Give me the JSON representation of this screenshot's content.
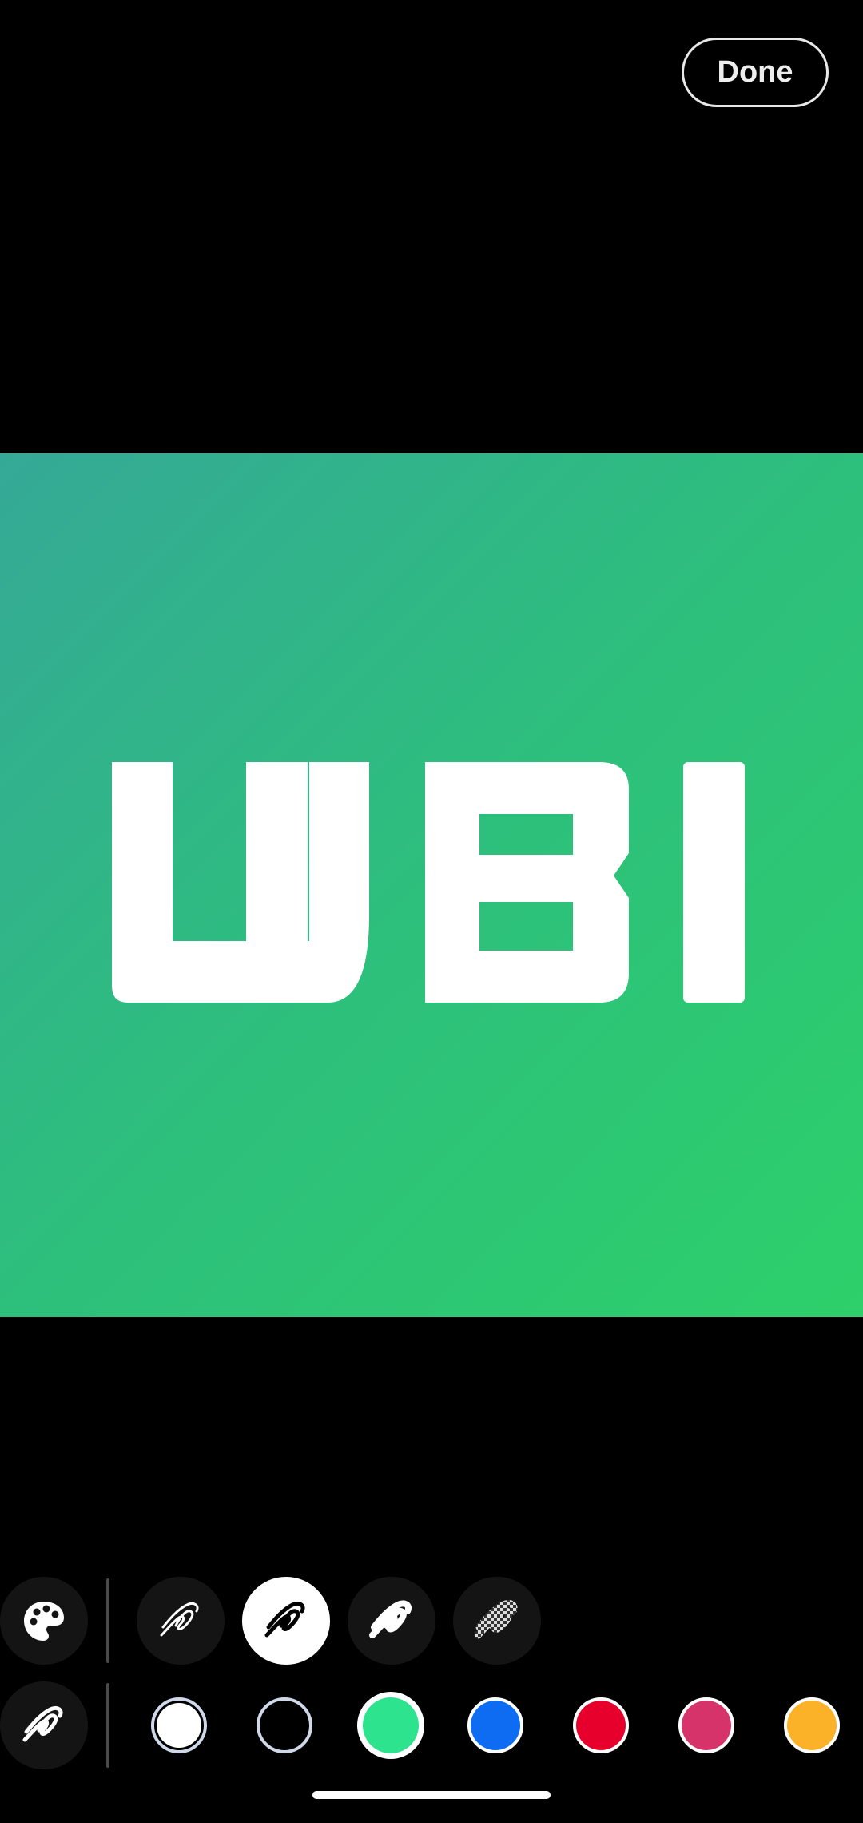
{
  "header": {
    "done_label": "Done"
  },
  "canvas": {
    "image": "wbi-logo-image",
    "logo_text": "WBI",
    "background_colors": [
      "#35a997",
      "#2dd06a"
    ]
  },
  "tools": {
    "palette": {
      "icon": "palette-icon"
    },
    "brushes": [
      {
        "name": "brush-thin",
        "icon": "squiggle-thin-icon",
        "selected": false
      },
      {
        "name": "brush-medium",
        "icon": "squiggle-medium-icon",
        "selected": true
      },
      {
        "name": "brush-thick",
        "icon": "squiggle-thick-icon",
        "selected": false
      },
      {
        "name": "brush-mosaic",
        "icon": "mosaic-brush-icon",
        "selected": false
      }
    ],
    "brush_style_toggle": {
      "icon": "squiggle-style-icon"
    }
  },
  "colors": [
    {
      "name": "white",
      "hex": "#ffffff"
    },
    {
      "name": "black",
      "hex": "#000000"
    },
    {
      "name": "green",
      "hex": "#2ee38e"
    },
    {
      "name": "blue",
      "hex": "#0d6cf2"
    },
    {
      "name": "red",
      "hex": "#e8002d"
    },
    {
      "name": "pink",
      "hex": "#d6336b"
    },
    {
      "name": "orange",
      "hex": "#fbb128"
    }
  ]
}
